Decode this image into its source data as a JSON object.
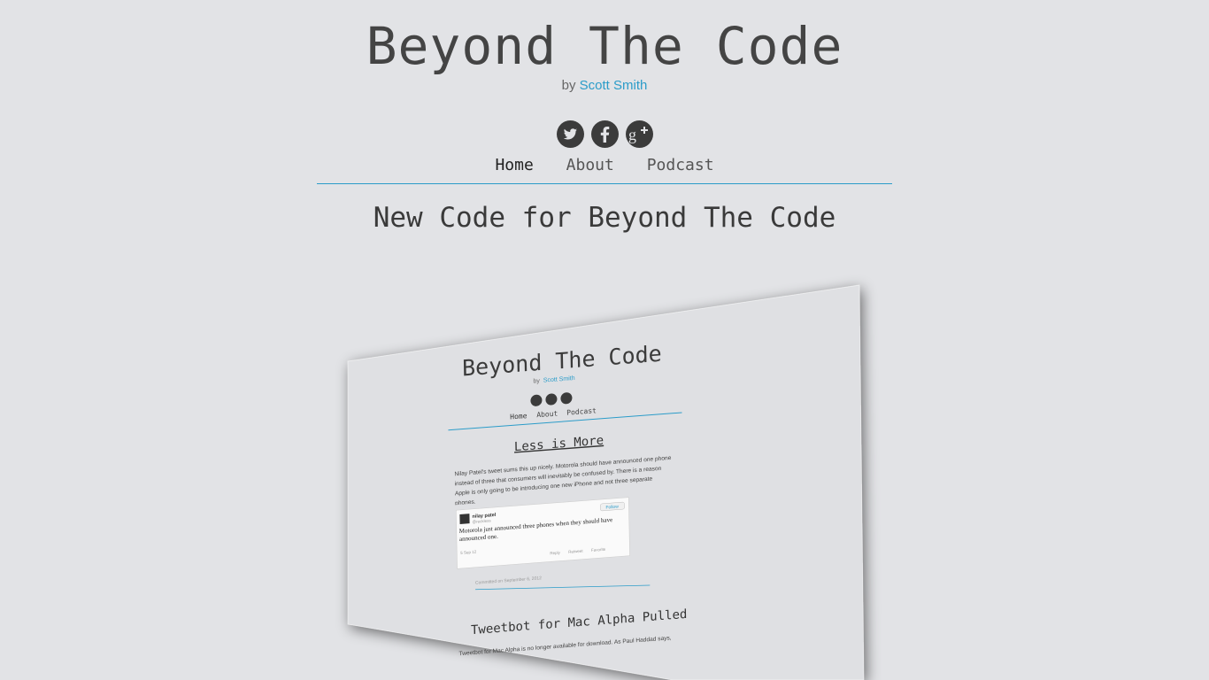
{
  "header": {
    "title": "Beyond The Code",
    "by_prefix": "by",
    "author": "Scott Smith"
  },
  "social": [
    {
      "name": "twitter-icon"
    },
    {
      "name": "facebook-icon"
    },
    {
      "name": "google-plus-icon"
    }
  ],
  "nav": {
    "items": [
      {
        "label": "Home"
      },
      {
        "label": "About"
      },
      {
        "label": "Podcast"
      }
    ]
  },
  "post": {
    "title": "New Code for Beyond The Code"
  },
  "screenshot": {
    "title": "Beyond The Code",
    "by_prefix": "by",
    "author": "Scott Smith",
    "nav": [
      "Home",
      "About",
      "Podcast"
    ],
    "post_title": "Less is More",
    "body": "Nilay Patel's tweet sums this up nicely. Motorola should have announced one phone instead of three that consumers will inevitably be confused by. There is a reason Apple is only going to be introducing one new iPhone and not three separate phones.",
    "tweet": {
      "name": "nilay patel",
      "handle": "@reckless",
      "follow": "Follow",
      "text": "Motorola just announced three phones when they should have announced one.",
      "date": "5 Sep 12",
      "reply": "Reply",
      "retweet": "Retweet",
      "favorite": "Favorite"
    },
    "committed": "Committed on September 6, 2012",
    "post2_title": "Tweetbot for Mac Alpha Pulled",
    "post2_body": "Tweetbot for Mac Alpha is no longer available for download. As Paul Haddad says,"
  },
  "colors": {
    "background": "#e2e3e6",
    "accent": "#2b9cc9",
    "text": "#444444"
  }
}
